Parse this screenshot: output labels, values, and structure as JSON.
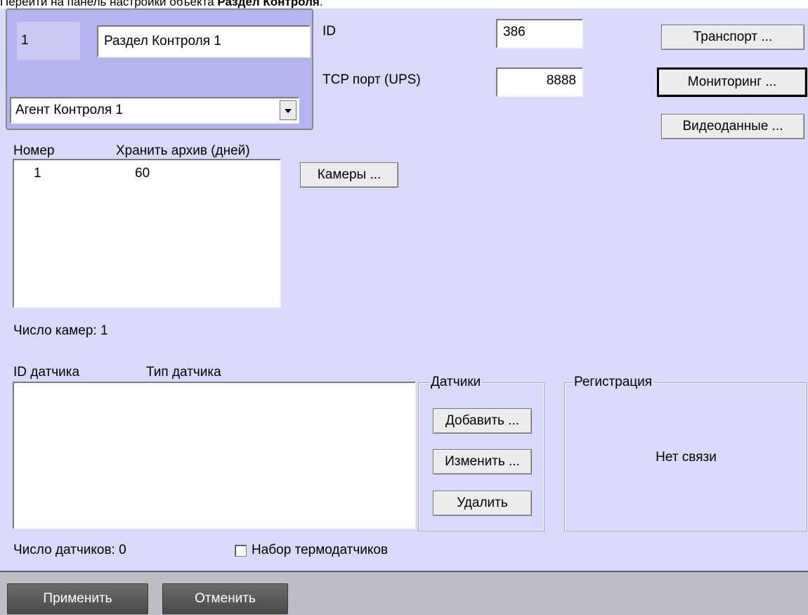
{
  "instruction": {
    "prefix": "Перейти на панель настройки объекта ",
    "object_name": "Раздел Контроля",
    "suffix": "."
  },
  "object": {
    "number": "1",
    "name": "Раздел Контроля 1",
    "parent_select": "Агент Контроля 1"
  },
  "id_field": {
    "label": "ID",
    "value": "386"
  },
  "tcp_port": {
    "label": "TCP порт (UPS)",
    "value": "8888"
  },
  "buttons": {
    "transport": "Транспорт ...",
    "monitoring": "Мониторинг ...",
    "video": "Видеоданные ...",
    "cameras": "Камеры ...",
    "add": "Добавить ...",
    "edit": "Изменить ...",
    "delete": "Удалить",
    "apply": "Применить",
    "cancel": "Отменить"
  },
  "cameras_table": {
    "headers": [
      "Номер",
      "Хранить архив (дней)"
    ],
    "rows": [
      {
        "number": "1",
        "archive_days": "60"
      }
    ],
    "count_label": "Число камер: 1"
  },
  "sensors_table": {
    "headers": [
      "ID датчика",
      "Тип датчика"
    ],
    "rows": [],
    "count_label": "Число датчиков: 0"
  },
  "sensors_group": {
    "title": "Датчики"
  },
  "registration_group": {
    "title": "Регистрация",
    "status": "Нет связи"
  },
  "thermo_checkbox": {
    "label": "Набор термодатчиков",
    "checked": false
  },
  "icons": {
    "dropdown": "chevron-down-icon"
  }
}
